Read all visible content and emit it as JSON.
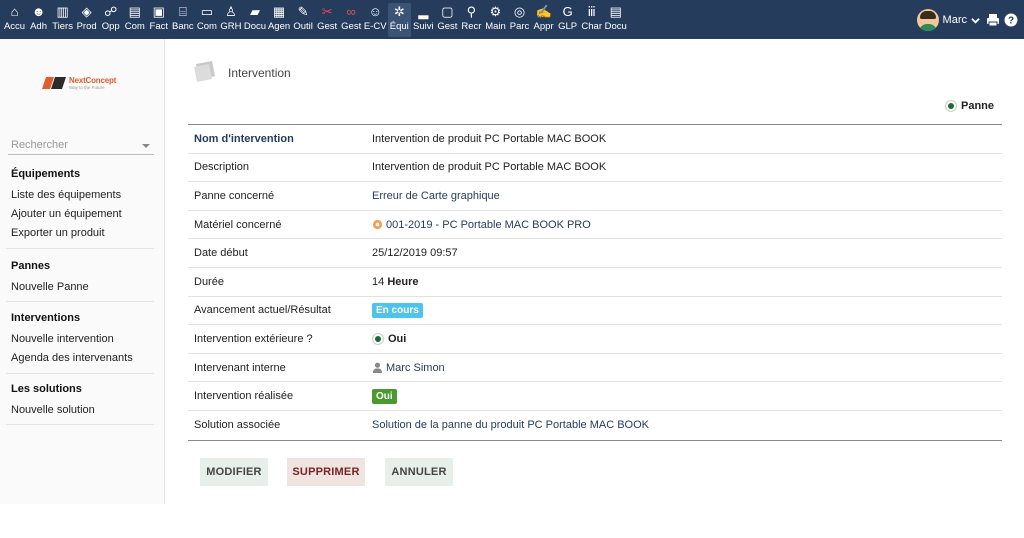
{
  "topbar": {
    "items": [
      {
        "icon": "home-icon",
        "label": "Accu"
      },
      {
        "icon": "users-icon",
        "label": "Adh"
      },
      {
        "icon": "building-icon",
        "label": "Tiers"
      },
      {
        "icon": "cube-icon",
        "label": "Prod"
      },
      {
        "icon": "sitemap-icon",
        "label": "Opp"
      },
      {
        "icon": "briefcase-icon",
        "label": "Com"
      },
      {
        "icon": "invoice-icon",
        "label": "Fact"
      },
      {
        "icon": "bank-icon",
        "label": "Banc"
      },
      {
        "icon": "money-icon",
        "label": "Com"
      },
      {
        "icon": "user-tie-icon",
        "label": "GRH"
      },
      {
        "icon": "folder-icon",
        "label": "Docu"
      },
      {
        "icon": "calendar-icon",
        "label": "Agen"
      },
      {
        "icon": "wrench-icon",
        "label": "Outil"
      },
      {
        "icon": "tools-red-icon",
        "label": "Gest"
      },
      {
        "icon": "glasses-icon",
        "label": "Gest"
      },
      {
        "icon": "cv-icon",
        "label": "E-CV"
      },
      {
        "icon": "gear-network-icon",
        "label": "Équi"
      },
      {
        "icon": "monitor-user-icon",
        "label": "Suivi"
      },
      {
        "icon": "presentation-icon",
        "label": "Gest"
      },
      {
        "icon": "magnifier-icon",
        "label": "Recr"
      },
      {
        "icon": "cog-icon",
        "label": "Main"
      },
      {
        "icon": "park-icon",
        "label": "Parc"
      },
      {
        "icon": "pen-user-icon",
        "label": "Appr"
      },
      {
        "icon": "glpi-icon",
        "label": "GLP"
      },
      {
        "icon": "chart-icon",
        "label": "Char"
      },
      {
        "icon": "ged-icon",
        "label": "Docu"
      }
    ],
    "active_index": 16,
    "user_name": "Marc"
  },
  "sidebar": {
    "search_placeholder": "Rechercher",
    "logo_text": "NextConcept",
    "logo_tagline": "Way to the Future",
    "groups": [
      {
        "title": "Équipements",
        "links": [
          "Liste des équipements",
          "Ajouter un équipement",
          "Exporter un produit"
        ]
      },
      {
        "title": "Pannes",
        "links": [
          "Nouvelle Panne"
        ]
      },
      {
        "title": "Interventions",
        "links": [
          "Nouvelle intervention",
          "Agenda des intervenants"
        ]
      },
      {
        "title": "Les solutions",
        "links": [
          "Nouvelle solution"
        ]
      }
    ]
  },
  "main": {
    "page_title": "Intervention",
    "status_label": "Panne",
    "rows": [
      {
        "label": "Nom d'intervention",
        "value": "Intervention de produit PC Portable MAC BOOK"
      },
      {
        "label": "Description",
        "value": "Intervention de produit PC Portable MAC BOOK"
      },
      {
        "label": "Panne concerné",
        "value": "Erreur de Carte graphique"
      },
      {
        "label": "Matériel concerné",
        "value": "001-2019 - PC Portable MAC BOOK PRO"
      },
      {
        "label": "Date début",
        "value": "25/12/2019 09:57"
      },
      {
        "label": "Durée",
        "value": "14",
        "unit": "Heure"
      },
      {
        "label": "Avancement actuel/Résultat",
        "value": "En cours"
      },
      {
        "label": "Intervention extérieure ?",
        "value": "Oui"
      },
      {
        "label": "Intervenant interne",
        "value": "Marc Simon"
      },
      {
        "label": "Intervention réalisée",
        "value": "Oui"
      },
      {
        "label": "Solution associée",
        "value": "Solution de la panne du produit PC Portable MAC BOOK"
      }
    ],
    "buttons": {
      "modify": "MODIFIER",
      "delete": "SUPPRIMER",
      "cancel": "ANNULER"
    }
  },
  "colors": {
    "topbar_bg": "#263c5c",
    "link": "#263c5c",
    "badge_blue": "#4fc3e8",
    "badge_green": "#4a9a2f",
    "status_dot": "#1e6b30"
  }
}
